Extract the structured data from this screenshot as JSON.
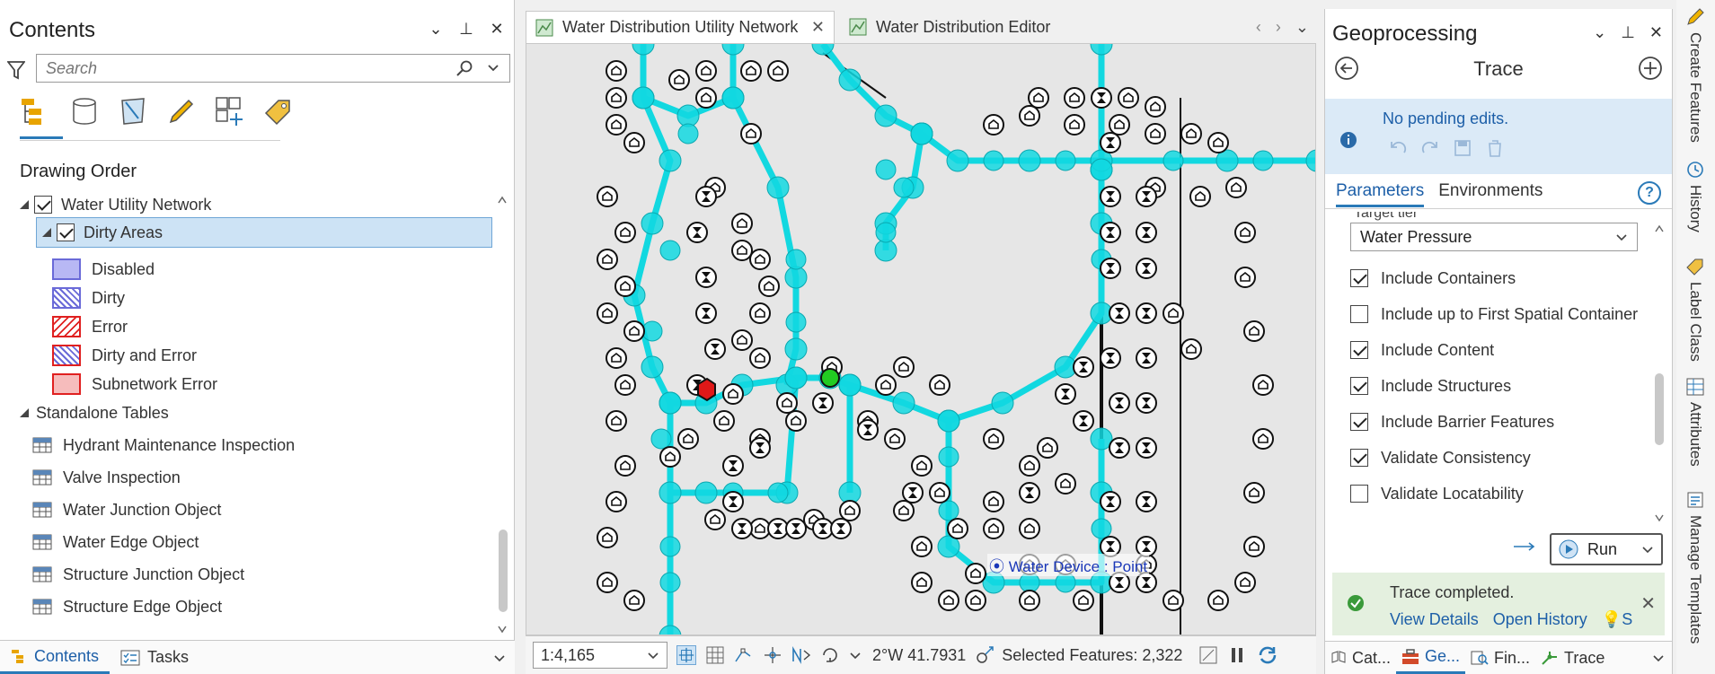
{
  "contents": {
    "title": "Contents",
    "search_placeholder": "Search",
    "section_title": "Drawing Order",
    "layers": {
      "network": "Water Utility Network",
      "dirty_areas": "Dirty Areas",
      "symbols": [
        "Disabled",
        "Dirty",
        "Error",
        "Dirty and Error",
        "Subnetwork Error"
      ]
    },
    "standalone_title": "Standalone Tables",
    "tables": [
      "Hydrant Maintenance Inspection",
      "Valve Inspection",
      "Water Junction Object",
      "Water Edge Object",
      "Structure Junction Object",
      "Structure Edge Object"
    ],
    "bottom_tabs": [
      "Contents",
      "Tasks"
    ]
  },
  "map": {
    "tabs": [
      "Water Distribution Utility Network",
      "Water Distribution Editor"
    ],
    "label": "Water Device : Point",
    "scale": "1:4,165",
    "coordinate": "2°W 41.7931",
    "selected_features": "Selected Features: 2,322"
  },
  "geoprocessing": {
    "title": "Geoprocessing",
    "tool": "Trace",
    "edits_message": "No pending edits.",
    "tabs": [
      "Parameters",
      "Environments"
    ],
    "help": "?",
    "partial_label": "Target tier",
    "target_value": "Water Pressure",
    "options": [
      {
        "label": "Include Containers",
        "checked": true
      },
      {
        "label": "Include up to First Spatial Container",
        "checked": false
      },
      {
        "label": "Include Content",
        "checked": true
      },
      {
        "label": "Include Structures",
        "checked": true
      },
      {
        "label": "Include Barrier Features",
        "checked": true
      },
      {
        "label": "Validate Consistency",
        "checked": true
      },
      {
        "label": "Validate Locatability",
        "checked": false
      }
    ],
    "run_label": "Run",
    "status": "Trace completed.",
    "status_links": [
      "View Details",
      "Open History",
      "Suggestions"
    ],
    "bottom_tabs": [
      "Cat...",
      "Ge...",
      "Fin...",
      "Trace"
    ]
  },
  "dock": [
    "Create Features",
    "History",
    "Label Class",
    "Attributes",
    "Manage Templates"
  ],
  "colors": {
    "trace": "#12d8e0",
    "accent": "#2a7ab8",
    "selection_fill": "#cde3f5",
    "flag_green": "#22cc22",
    "barrier_red": "#e01818"
  }
}
